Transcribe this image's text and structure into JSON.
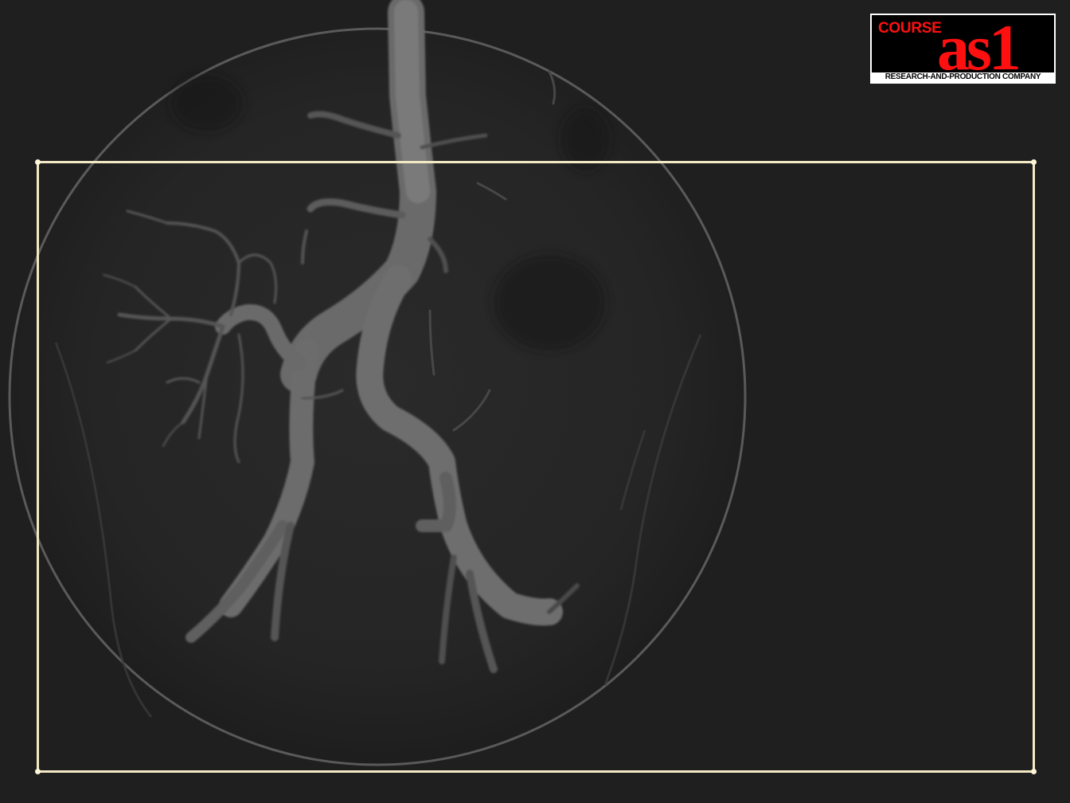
{
  "image": {
    "subject": "abdominal aortic angiogram",
    "background_color": "#1f1f1f"
  },
  "overlay": {
    "frame_color": "#f3e9c4"
  },
  "logo": {
    "word": "COURSE",
    "mark": "as1",
    "tagline": "RESEARCH-AND-PRODUCTION COMPANY",
    "accent_color": "#ff1010",
    "background_color": "#000000"
  }
}
